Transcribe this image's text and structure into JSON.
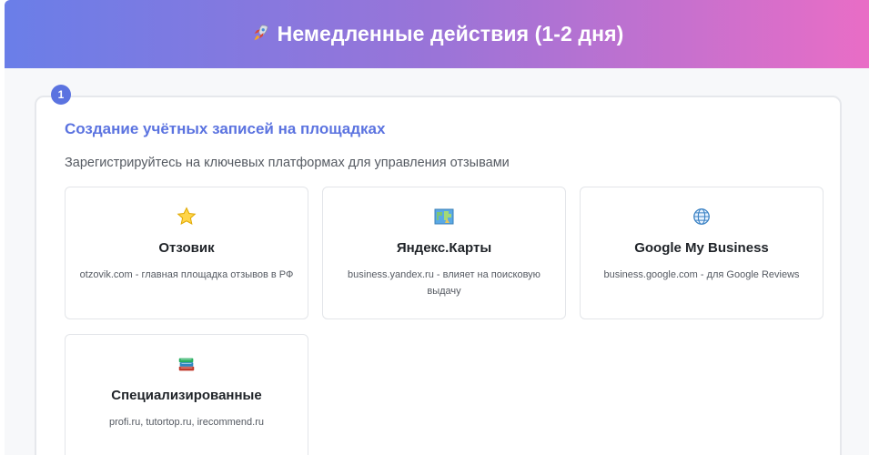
{
  "header": {
    "icon": "rocket-icon",
    "title": "Немедленные действия (1-2 дня)"
  },
  "step": {
    "number": "1",
    "title": "Создание учётных записей на площадках",
    "description": "Зарегистрируйтесь на ключевых платформах для управления отзывами"
  },
  "platforms": [
    {
      "icon": "star-icon",
      "name": "Отзовик",
      "description": "otzovik.com - главная площадка отзывов в РФ"
    },
    {
      "icon": "map-icon",
      "name": "Яндекс.Карты",
      "description": "business.yandex.ru - влияет на поисковую выдачу"
    },
    {
      "icon": "globe-icon",
      "name": "Google My Business",
      "description": "business.google.com - для Google Reviews"
    },
    {
      "icon": "books-icon",
      "name": "Специализированные",
      "description": "profi.ru, tutortop.ru, irecommend.ru"
    }
  ],
  "colors": {
    "accent": "#5b73e0",
    "gradient_start": "#6a7ee8",
    "gradient_end": "#e96dc6"
  }
}
